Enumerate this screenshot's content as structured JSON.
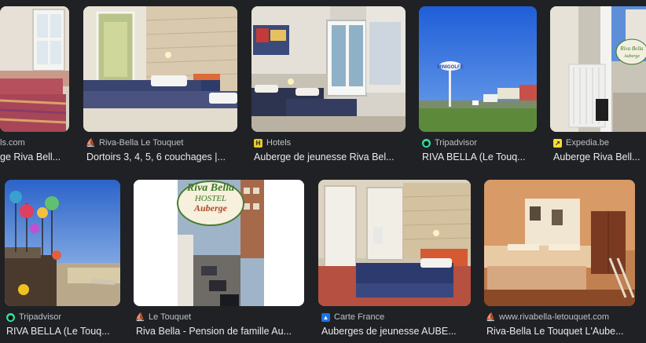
{
  "results": [
    {
      "source": "ls.com",
      "title": "ge Riva Bell...",
      "icon": "none"
    },
    {
      "source": "Riva-Bella Le Touquet",
      "title": "Dortoirs 3, 4, 5, 6 couchages |...",
      "icon": "sailboat-icon"
    },
    {
      "source": "Hotels",
      "title": "Auberge de jeunesse Riva Bel...",
      "icon": "hotels-icon"
    },
    {
      "source": "Tripadvisor",
      "title": "RIVA BELLA (Le Touq...",
      "icon": "tripadvisor-icon"
    },
    {
      "source": "Expedia.be",
      "title": "Auberge Riva Bell...",
      "icon": "expedia-icon"
    },
    {
      "source": "Tripadvisor",
      "title": "RIVA BELLA (Le Touq...",
      "icon": "tripadvisor-icon"
    },
    {
      "source": "Le Touquet",
      "title": "Riva Bella - Pension de famille Au...",
      "icon": "sailboat-icon"
    },
    {
      "source": "Carte France",
      "title": "Auberges de jeunesse AUBE...",
      "icon": "carte-france-icon"
    },
    {
      "source": "www.rivabella-letouquet.com",
      "title": "Riva-Bella Le Touquet L'Aube...",
      "icon": "sailboat-icon"
    }
  ],
  "sign": {
    "line1": "Riva Bella",
    "line2": "HOSTEL",
    "line3": "Auberge"
  },
  "colors": {
    "background": "#202124",
    "text": "#e8eaed",
    "muted": "#bdc1c6"
  }
}
